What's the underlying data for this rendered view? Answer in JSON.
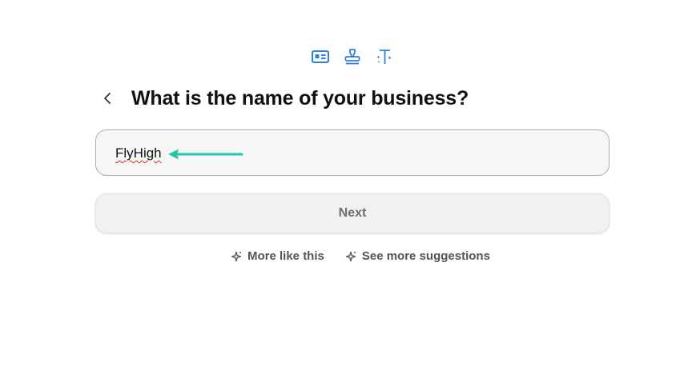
{
  "header": {
    "steps": [
      {
        "icon": "id-card-icon"
      },
      {
        "icon": "stamp-icon"
      },
      {
        "icon": "text-sparkle-icon"
      }
    ],
    "title": "What is the name of your business?"
  },
  "form": {
    "business_name_value": "FlyHigh",
    "next_label": "Next"
  },
  "suggestions": {
    "more_like_this": "More like this",
    "see_more": "See more suggestions"
  },
  "colors": {
    "accent": "#2f7fe0",
    "annotation_arrow": "#1fc9a5",
    "spellcheck": "#d93025"
  }
}
